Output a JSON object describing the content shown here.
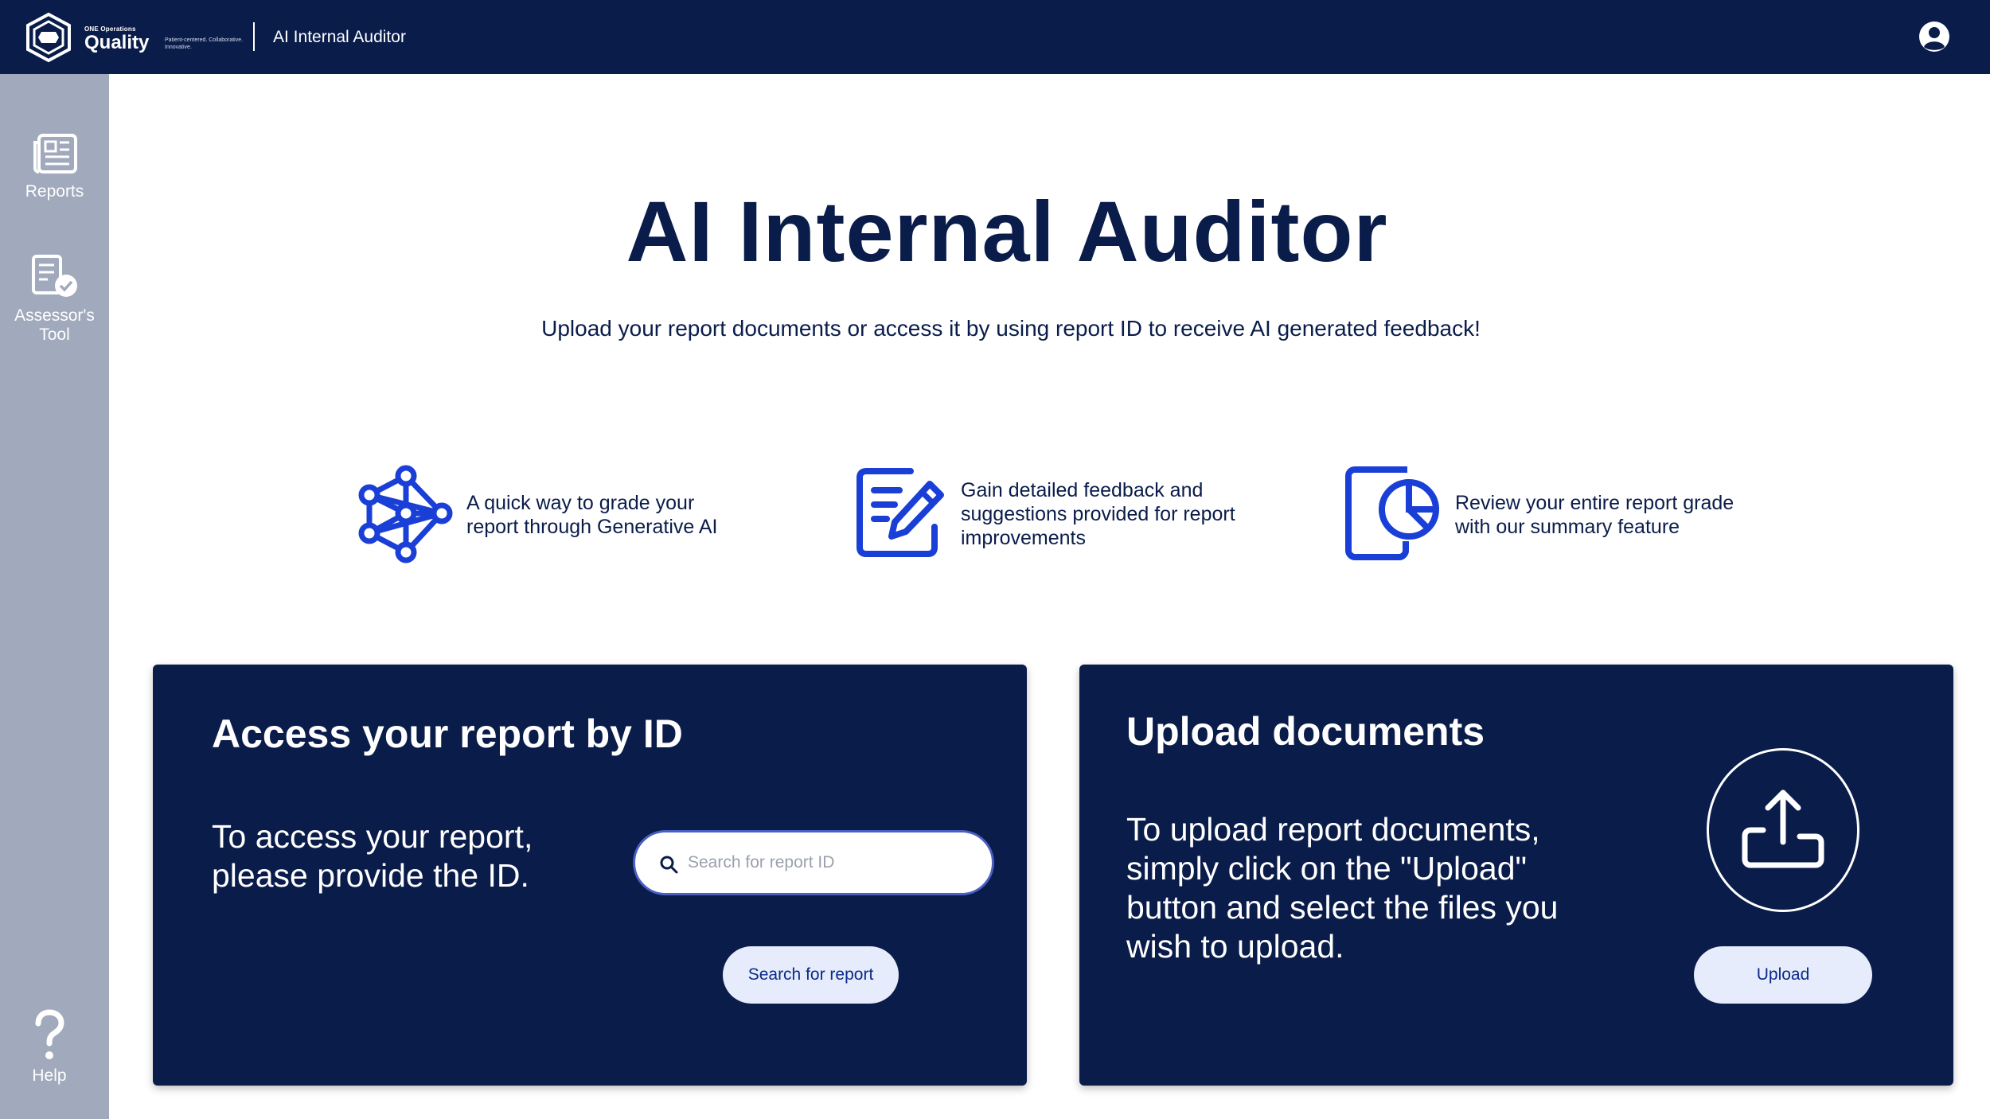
{
  "header": {
    "brand_small": "ONE Operations",
    "brand_name": "Quality",
    "brand_tagline": "Patient-centered. Collaborative. Innovative.",
    "app_title": "AI Internal Auditor"
  },
  "sidebar": {
    "items": [
      {
        "label": "Reports",
        "icon": "newspaper-icon"
      },
      {
        "label": "Assessor's Tool",
        "icon": "checklist-icon"
      }
    ],
    "help_label": "Help"
  },
  "hero": {
    "title": "AI Internal Auditor",
    "subtitle": "Upload your report documents or access it by using report ID to receive AI generated feedback!"
  },
  "features": [
    {
      "icon": "network-icon",
      "text": "A quick way to grade your report through Generative AI"
    },
    {
      "icon": "edit-document-icon",
      "text": "Gain detailed feedback and suggestions provided for report improvements"
    },
    {
      "icon": "report-chart-icon",
      "text": "Review your entire report grade with our summary feature"
    }
  ],
  "access_card": {
    "title": "Access your report by ID",
    "text": "To access your report, please provide the ID.",
    "search_placeholder": "Search for report ID",
    "search_value": "",
    "button_label": "Search for report"
  },
  "upload_card": {
    "title": "Upload documents",
    "text": "To upload report documents, simply click on the \"Upload\" button and select the files you wish to upload.",
    "button_label": "Upload"
  },
  "colors": {
    "navy": "#0a1c4a",
    "sidebar": "#a1a9bc",
    "accent_blue": "#1a3fd6",
    "button_bg": "#e6ecfb"
  }
}
